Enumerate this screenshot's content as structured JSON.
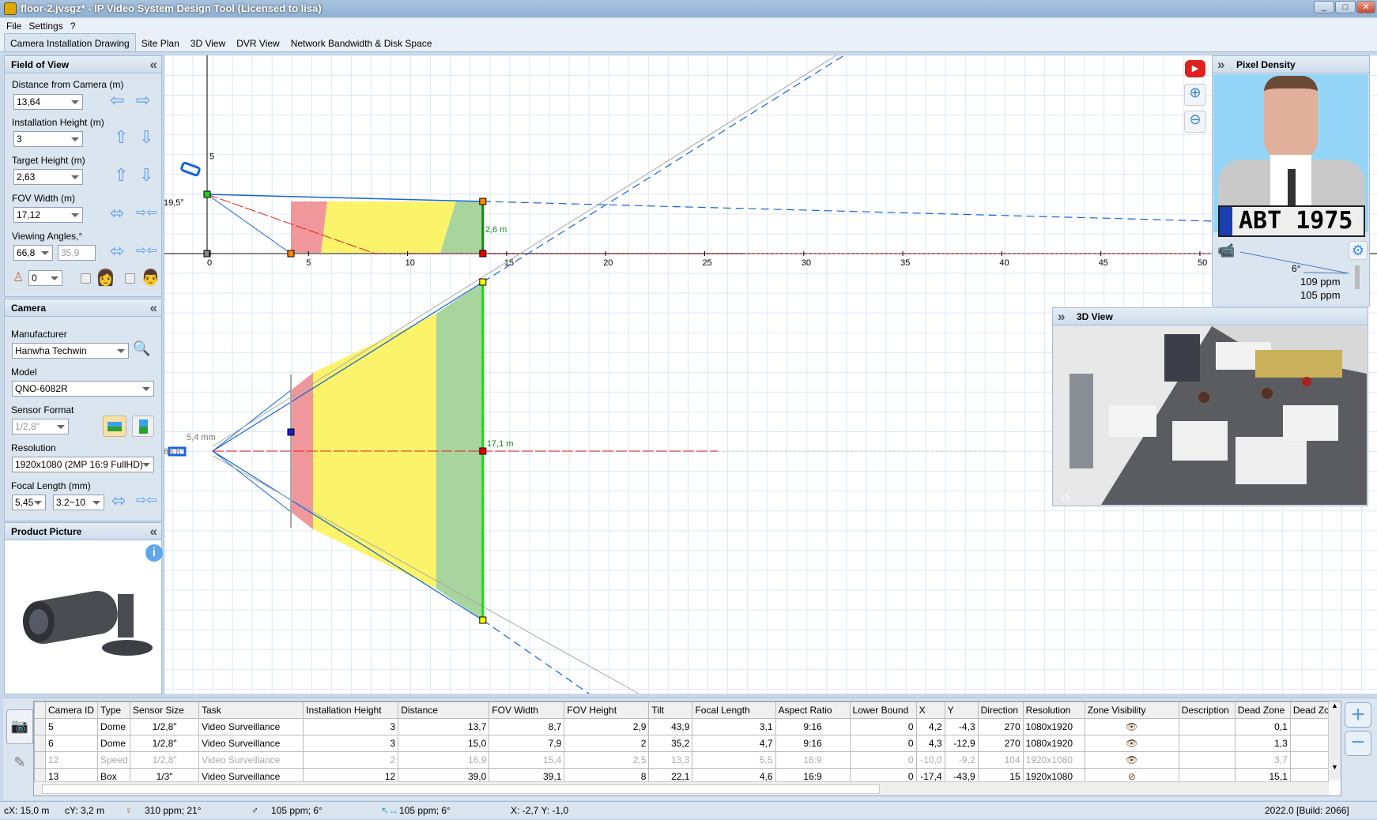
{
  "window": {
    "title": "floor-2.jvsgz* - IP Video System Design Tool (Licensed to lisa)",
    "minimize": "_",
    "maximize": "□",
    "close": "✕"
  },
  "menu": [
    "File",
    "Settings",
    "?"
  ],
  "tabs": [
    "Camera Installation Drawing",
    "Site Plan",
    "3D View",
    "DVR View",
    "Network Bandwidth & Disk Space"
  ],
  "fov": {
    "title": "Field of View",
    "distance_label": "Distance from Camera  (m)",
    "distance": "13,64",
    "install_height_label": "Installation Height (m)",
    "install_height": "3",
    "target_height_label": "Target Height (m)",
    "target_height": "2,63",
    "fov_width_label": "FOV Width (m)",
    "fov_width": "17,12",
    "angles_label": "Viewing Angles,°",
    "angle_h": "66,8",
    "angle_v": "35,9",
    "offset": "0"
  },
  "camera": {
    "title": "Camera",
    "manufacturer_label": "Manufacturer",
    "manufacturer": "Hanwha Techwin",
    "model_label": "Model",
    "model": "QNO-6082R",
    "sensor_label": "Sensor Format",
    "sensor": "1/2,8\"",
    "resolution_label": "Resolution",
    "resolution": "1920x1080 (2MP 16:9 FullHD)",
    "focal_label": "Focal Length (mm)",
    "focal": "5,45",
    "focal_range": "3.2~10"
  },
  "product": {
    "title": "Product Picture",
    "info": "i"
  },
  "drawing": {
    "x_ticks": [
      "0",
      "5",
      "10",
      "15",
      "20",
      "25",
      "30",
      "35",
      "40",
      "45",
      "50"
    ],
    "y_tick": "5",
    "tilt_angle": "19,5°",
    "target_height_marker": "2,6 m",
    "h_angle": "66,8°",
    "focal_marker": "5,4 mm",
    "fov_width_marker": "17,1 m",
    "colors": {
      "red_zone": "#f0979b",
      "yellow_zone": "#fbf36a",
      "green_zone": "#a8d49d",
      "fov_line": "#1565d8"
    }
  },
  "pixel_density": {
    "title": "Pixel Density",
    "plate": "ABT 1975",
    "angle": "6°",
    "ppm1": "109 ppm",
    "ppm2": "105 ppm"
  },
  "view3d": {
    "title": "3D View",
    "camera_no": "15"
  },
  "table": {
    "columns": [
      "",
      "Camera ID",
      "Type",
      "Sensor Size",
      "Task",
      "Installation Height",
      "Distance",
      "FOV Width",
      "FOV Height",
      "Tilt",
      "Focal Length",
      "Aspect Ratio",
      "Lower Bound",
      "X",
      "Y",
      "Direction",
      "Resolution",
      "Zone Visibility",
      "Description",
      "Dead Zone",
      "Dead Zc"
    ],
    "rows": [
      {
        "id": "5",
        "type": "Dome",
        "sensor": "1/2,8\"",
        "task": "Video Surveillance",
        "height": "3",
        "distance": "13,7",
        "fov_w": "8,7",
        "fov_h": "2,9",
        "tilt": "43,9",
        "focal": "3,1",
        "aspect": "9:16",
        "lower": "0",
        "x": "4,2",
        "y": "-4,3",
        "dir": "270",
        "res": "1080x1920",
        "vis": "visible",
        "desc": "",
        "dead": "0,1",
        "disabled": false
      },
      {
        "id": "6",
        "type": "Dome",
        "sensor": "1/2,8\"",
        "task": "Video Surveillance",
        "height": "3",
        "distance": "15,0",
        "fov_w": "7,9",
        "fov_h": "2",
        "tilt": "35,2",
        "focal": "4,7",
        "aspect": "9:16",
        "lower": "0",
        "x": "4,3",
        "y": "-12,9",
        "dir": "270",
        "res": "1080x1920",
        "vis": "visible",
        "desc": "",
        "dead": "1,3",
        "disabled": false
      },
      {
        "id": "12",
        "type": "Speed",
        "sensor": "1/2,8\"",
        "task": "Video Surveillance",
        "height": "2",
        "distance": "16,9",
        "fov_w": "15,4",
        "fov_h": "2,5",
        "tilt": "13,3",
        "focal": "5,5",
        "aspect": "16:9",
        "lower": "0",
        "x": "-10,0",
        "y": "-9,2",
        "dir": "104",
        "res": "1920x1080",
        "vis": "visible",
        "desc": "",
        "dead": "3,7",
        "disabled": true
      },
      {
        "id": "13",
        "type": "Box",
        "sensor": "1/3\"",
        "task": "Video Surveillance",
        "height": "12",
        "distance": "39,0",
        "fov_w": "39,1",
        "fov_h": "8",
        "tilt": "22,1",
        "focal": "4,6",
        "aspect": "16:9",
        "lower": "0",
        "x": "-17,4",
        "y": "-43,9",
        "dir": "15",
        "res": "1920x1080",
        "vis": "hidden",
        "desc": "",
        "dead": "15,1",
        "disabled": false
      }
    ]
  },
  "status": {
    "cx": "cX: 15,0 m",
    "cy": "cY: 3,2 m",
    "female": "310 ppm; 21°",
    "male": "105 ppm; 6°",
    "cursor": "105 ppm; 6°",
    "xy": "X: -2,7 Y: -1,0",
    "build": "2022.0 [Build: 2066]"
  }
}
